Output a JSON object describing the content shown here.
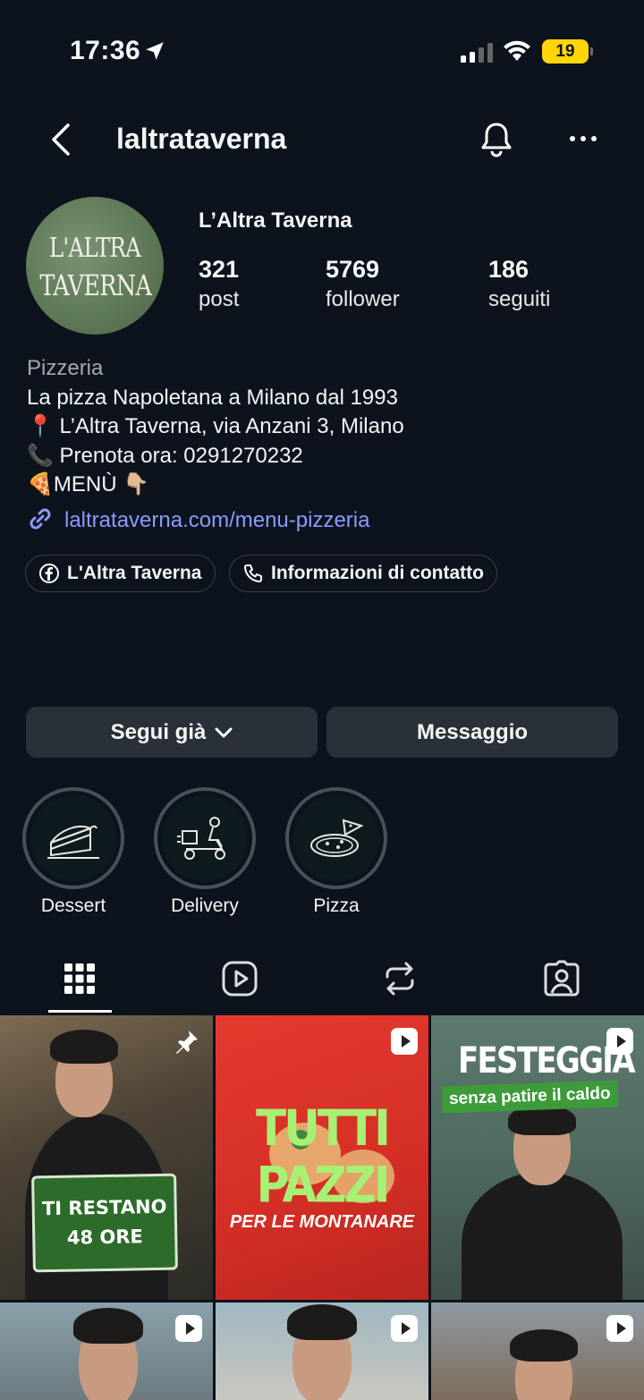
{
  "status_bar": {
    "time": "17:36",
    "battery": "19"
  },
  "header": {
    "username": "laltrataverna"
  },
  "profile": {
    "avatar_text_line1": "L'ALTRA",
    "avatar_text_line2": "TAVERNA",
    "display_name": "L’Altra Taverna",
    "stats": [
      {
        "value": "321",
        "label": "post"
      },
      {
        "value": "5769",
        "label": "follower"
      },
      {
        "value": "186",
        "label": "seguiti"
      }
    ],
    "category": "Pizzeria",
    "bio_lines": [
      "La pizza Napoletana a Milano dal 1993",
      "📍 L’Altra Taverna, via Anzani 3, Milano",
      "📞 Prenota ora: 0291270232",
      "🍕MENÙ 👇🏼"
    ],
    "link": "laltrataverna.com/menu-pizzeria",
    "chips": [
      {
        "label": "L'Altra Taverna",
        "icon": "facebook-icon"
      },
      {
        "label": "Informazioni di contatto",
        "icon": "phone-icon"
      }
    ],
    "buttons": {
      "follow": "Segui già",
      "message": "Messaggio"
    }
  },
  "highlights": [
    {
      "label": "Dessert",
      "icon": "cake-slice-icon"
    },
    {
      "label": "Delivery",
      "icon": "scooter-icon"
    },
    {
      "label": "Pizza",
      "icon": "pizza-icon"
    }
  ],
  "tabs": [
    {
      "name": "grid",
      "icon": "grid-icon",
      "active": true
    },
    {
      "name": "reels",
      "icon": "reels-icon"
    },
    {
      "name": "reposts",
      "icon": "repost-icon"
    },
    {
      "name": "tagged",
      "icon": "tagged-icon"
    }
  ],
  "posts": [
    {
      "overlay_line1": "TI RESTANO",
      "overlay_line2": "48 ORE",
      "pinned": true
    },
    {
      "overlay_line1": "TUTTI PAZZI",
      "overlay_line2": "PER LE MONTANARE",
      "type": "reel"
    },
    {
      "overlay_line1": "FESTEGGIA",
      "overlay_line2": "senza patire il caldo",
      "type": "reel"
    },
    {
      "type": "reel"
    },
    {
      "type": "reel"
    },
    {
      "type": "reel"
    }
  ]
}
